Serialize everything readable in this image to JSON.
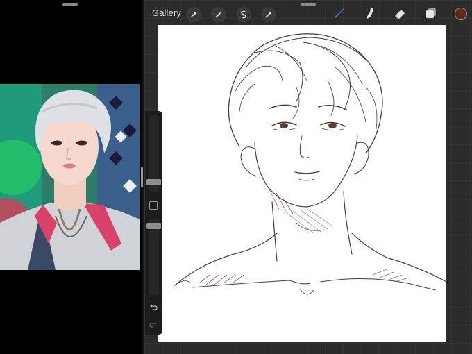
{
  "toolbar": {
    "gallery_label": "Gallery",
    "left_tools": [
      "wrench-icon",
      "magic-wand-icon",
      "selection-s-icon",
      "transform-arrow-icon"
    ],
    "right_tools": [
      "brush-icon",
      "smudge-icon",
      "eraser-icon",
      "layers-icon"
    ],
    "active_tool": "brush",
    "active_tool_color": "#2f7de0",
    "current_color": "#5a2a14"
  },
  "sidebar": {
    "brush_size_level": 0.55,
    "opacity_level": 0.4,
    "buttons": [
      "modify-button",
      "undo-icon",
      "redo-icon"
    ]
  },
  "colors": {
    "app_background": "#2b2b2b",
    "sketch_stroke": "#4a3a34",
    "reference_pane_background": "#000000"
  }
}
